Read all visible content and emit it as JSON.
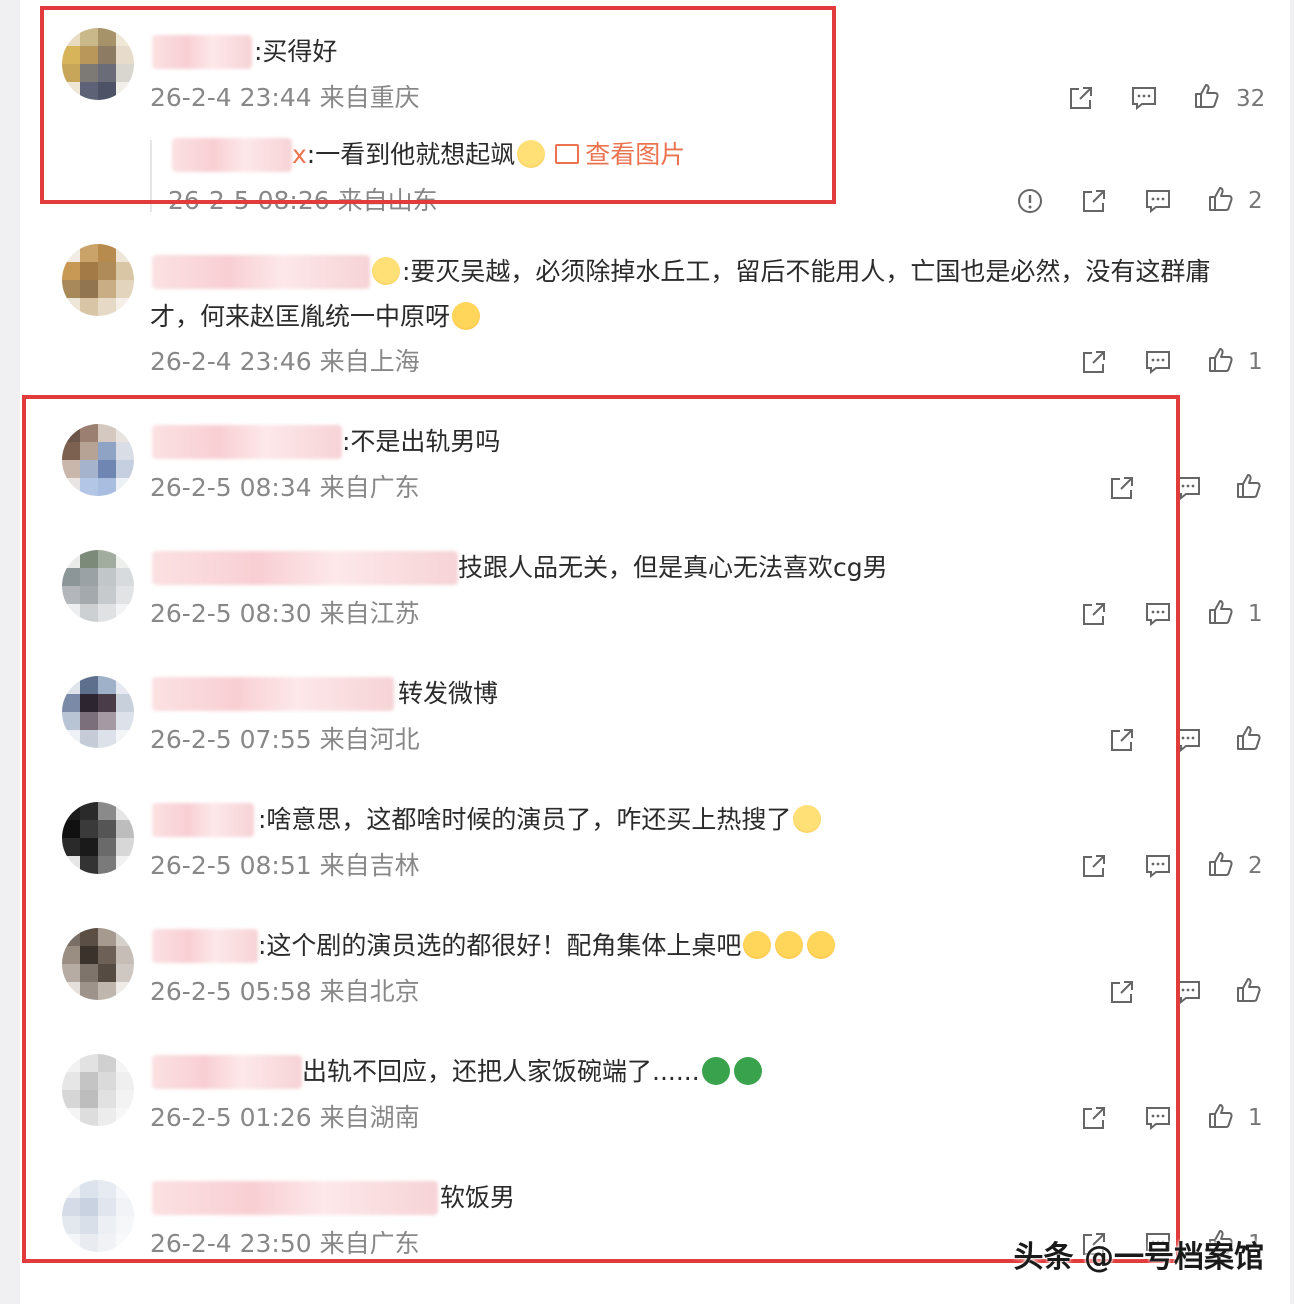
{
  "comments": [
    {
      "text": ":买得好",
      "meta": "26-2-4 23:44 来自重庆",
      "likes": "32",
      "reply": {
        "prefix": "x",
        "text": ":一看到他就想起飒",
        "image_link": "查看图片",
        "meta": "26-2-5 08:26 来自山东",
        "likes": "2"
      }
    },
    {
      "text_line1": ":要灭吴越，必须除掉水丘工，留后不能用人，亡国也是必然，没有这群庸",
      "text_line2": "才，何来赵匡胤统一中原呀",
      "meta": "26-2-4 23:46 来自上海",
      "likes": "1"
    },
    {
      "text": ":不是出轨男吗",
      "meta": "26-2-5 08:34 来自广东",
      "likes": ""
    },
    {
      "text": "技跟人品无关，但是真心无法喜欢cg男",
      "meta": "26-2-5 08:30 来自江苏",
      "likes": "1"
    },
    {
      "text": "转发微博",
      "meta": "26-2-5 07:55 来自河北",
      "likes": ""
    },
    {
      "text": ":啥意思，这都啥时候的演员了，咋还买上热搜了",
      "meta": "26-2-5 08:51 来自吉林",
      "likes": "2"
    },
    {
      "text": ":这个剧的演员选的都很好！配角集体上桌吧",
      "meta": "26-2-5 05:58 来自北京",
      "likes": ""
    },
    {
      "text": "出轨不回应，还把人家饭碗端了......",
      "meta": "26-2-5 01:26 来自湖南",
      "likes": "1"
    },
    {
      "text": "软饭男",
      "meta": "26-2-4 23:50 来自广东",
      "likes": "1"
    }
  ],
  "watermark": "头条 @一号档案馆",
  "colors": {
    "highlight_box": "#e23b3b",
    "link": "#eb7350",
    "meta": "#888888"
  },
  "icons": [
    "share-icon",
    "comment-icon",
    "like-icon",
    "report-icon",
    "image-icon"
  ]
}
